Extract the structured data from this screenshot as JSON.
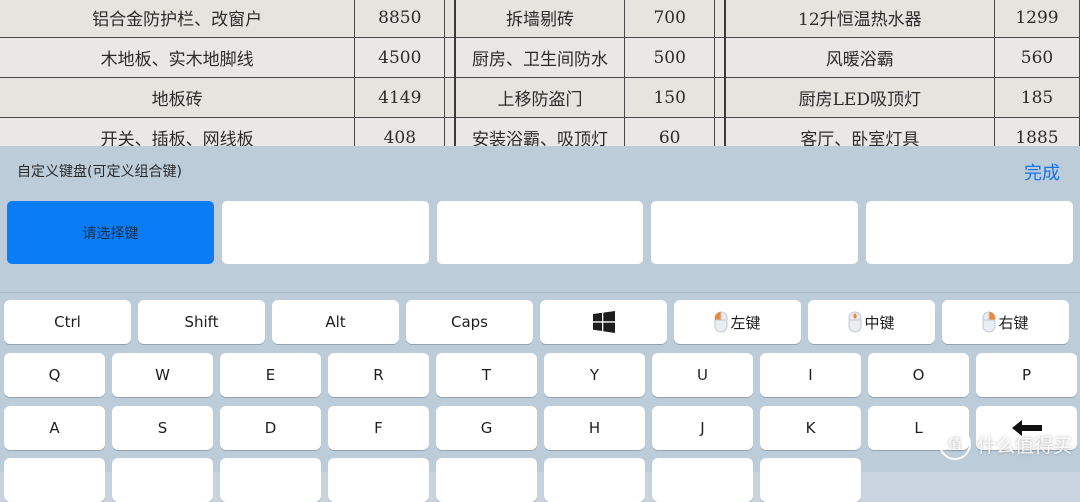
{
  "document": {
    "rows": [
      [
        "铝合金防护栏、改窗户",
        "8850",
        "拆墙剔砖",
        "700",
        "12升恒温热水器",
        "1299"
      ],
      [
        "木地板、实木地脚线",
        "4500",
        "厨房、卫生间防水",
        "500",
        "风暖浴霸",
        "560"
      ],
      [
        "地板砖",
        "4149",
        "上移防盗门",
        "150",
        "厨房LED吸顶灯",
        "185"
      ],
      [
        "开关、插板、网线板",
        "408",
        "安装浴霸、吸顶灯",
        "60",
        "客厅、卧室灯具",
        "1885"
      ]
    ]
  },
  "panel": {
    "title": "自定义键盘(可定义组合键)",
    "done_label": "完成",
    "slots": [
      "请选择键",
      "",
      "",
      "",
      ""
    ]
  },
  "keyboard": {
    "row1": [
      {
        "label": "Ctrl",
        "icon": ""
      },
      {
        "label": "Shift",
        "icon": ""
      },
      {
        "label": "Alt",
        "icon": ""
      },
      {
        "label": "Caps",
        "icon": ""
      },
      {
        "label": "",
        "icon": "windows-logo-icon"
      },
      {
        "label": "左键",
        "icon": "mouse-left-icon"
      },
      {
        "label": "中键",
        "icon": "mouse-middle-icon"
      },
      {
        "label": "右键",
        "icon": "mouse-right-icon"
      }
    ],
    "row2": [
      "Q",
      "W",
      "E",
      "R",
      "T",
      "Y",
      "U",
      "I",
      "O",
      "P"
    ],
    "row3": [
      "A",
      "S",
      "D",
      "F",
      "G",
      "H",
      "J",
      "K",
      "L"
    ],
    "backspace_icon": "backspace-arrow-icon"
  },
  "watermark": {
    "logo_glyph": "值",
    "text": "什么值得买"
  },
  "colors": {
    "accent": "#0a7cf5",
    "done_link": "#1a73e8",
    "panel_bg": "#bcccd9",
    "mouse_highlight": "#f0883a"
  }
}
